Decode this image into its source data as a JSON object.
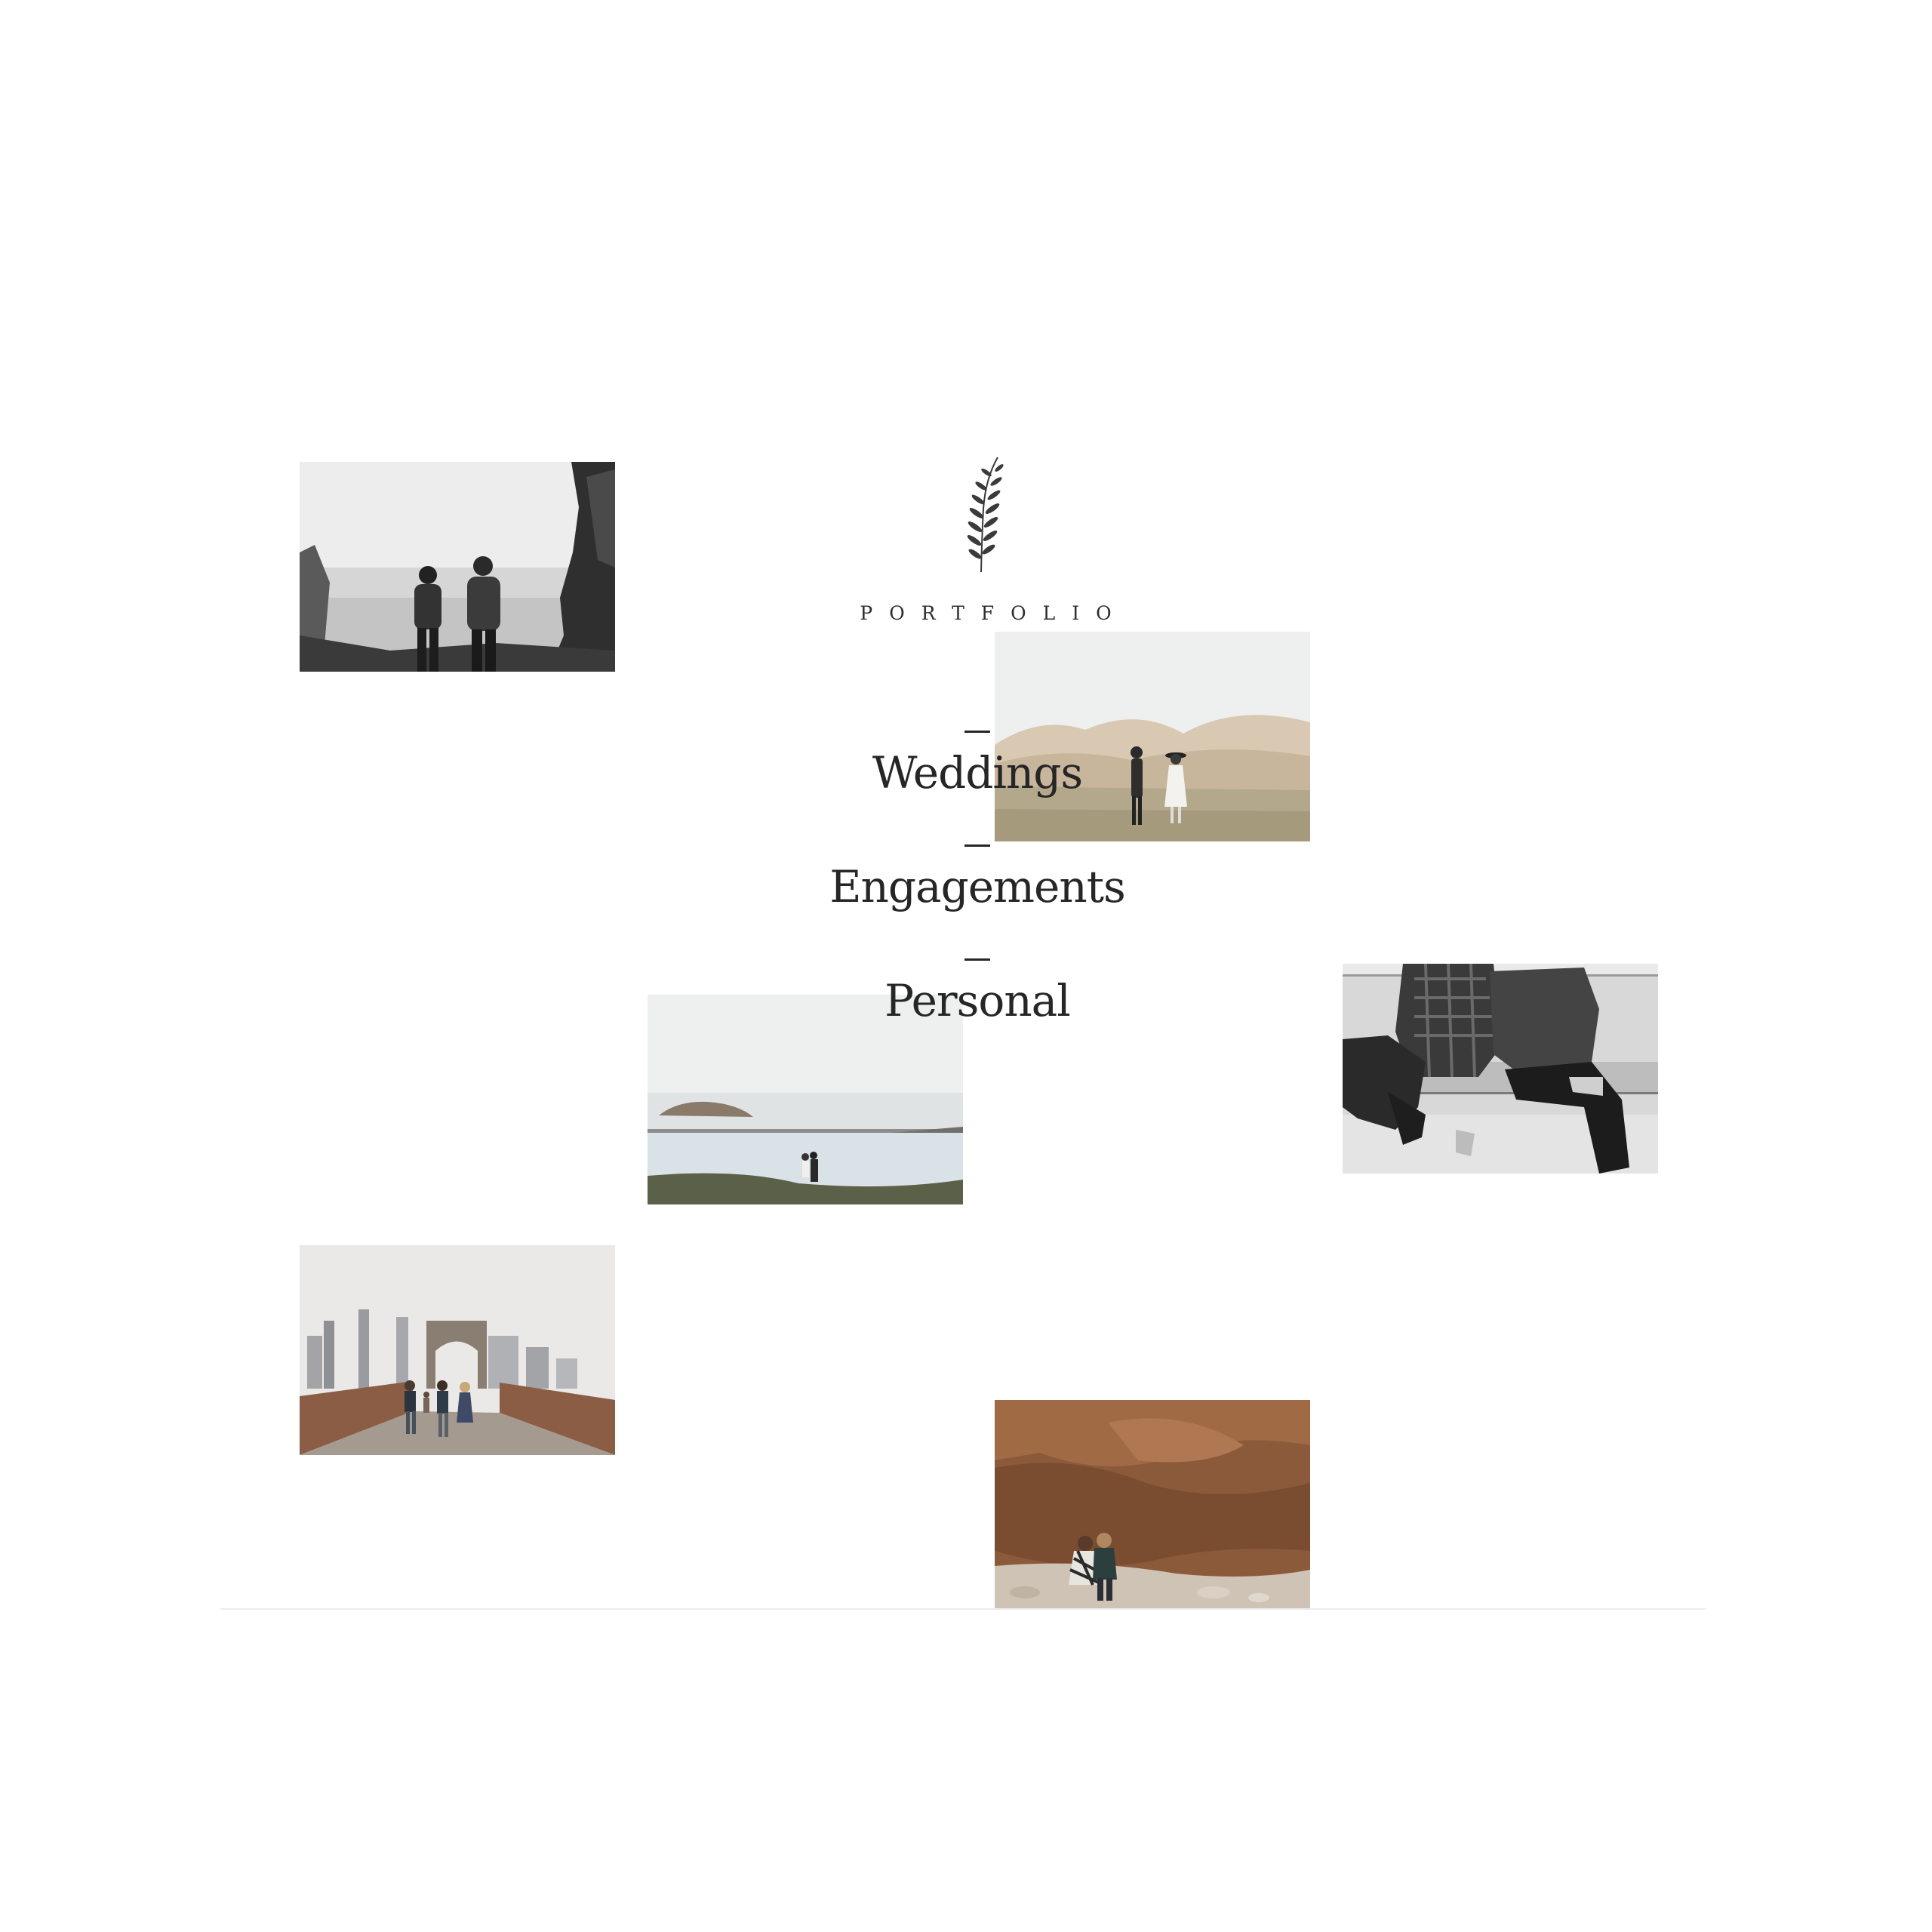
{
  "header": {
    "logo_icon": "olive-branch-icon",
    "title": "PORTFOLIO"
  },
  "menu": {
    "items": [
      {
        "label": "Weddings"
      },
      {
        "label": "Engagements"
      },
      {
        "label": "Personal"
      }
    ]
  },
  "gallery": {
    "photos": [
      {
        "name": "couple-on-rocky-shore-bw"
      },
      {
        "name": "couple-in-hills-meadow"
      },
      {
        "name": "couple-by-foggy-sea-pool"
      },
      {
        "name": "couple-sitting-on-steps-bw"
      },
      {
        "name": "group-on-brooklyn-bridge"
      },
      {
        "name": "couple-under-red-rock"
      }
    ]
  },
  "colors": {
    "background": "#ffffff",
    "text": "#262626",
    "divider": "#ececec"
  }
}
